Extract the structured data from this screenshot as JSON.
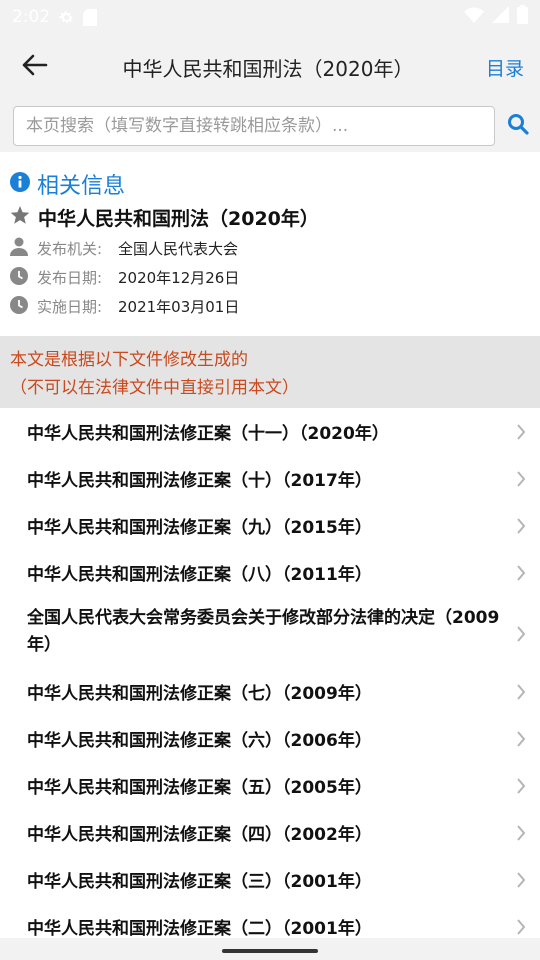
{
  "status_bar": {
    "time": "2:02",
    "icons": [
      "gear-icon",
      "sd-card-icon",
      "wifi-icon",
      "signal-icon",
      "battery-icon"
    ]
  },
  "app_bar": {
    "title": "中华人民共和国刑法（2020年）",
    "toc_label": "目录",
    "back_icon": "arrow-left-icon"
  },
  "search": {
    "placeholder": "本页搜索（填写数字直接转跳相应条款）...",
    "value": ""
  },
  "info": {
    "heading": "相关信息",
    "law_title": "中华人民共和国刑法（2020年）",
    "rows": [
      {
        "key": "发布机关:",
        "value": "全国人民代表大会",
        "icon": "person-icon"
      },
      {
        "key": "发布日期:",
        "value": "2020年12月26日",
        "icon": "clock-icon"
      },
      {
        "key": "实施日期:",
        "value": "2021年03月01日",
        "icon": "clock-icon"
      }
    ]
  },
  "notice": {
    "line1": "本文是根据以下文件修改生成的",
    "line2": "（不可以在法律文件中直接引用本文）"
  },
  "amendments": [
    "中华人民共和国刑法修正案（十一）（2020年）",
    "中华人民共和国刑法修正案（十）（2017年）",
    "中华人民共和国刑法修正案（九）（2015年）",
    "中华人民共和国刑法修正案（八）（2011年）",
    "全国人民代表大会常务委员会关于修改部分法律的决定（2009年）",
    "中华人民共和国刑法修正案（七）（2009年）",
    "中华人民共和国刑法修正案（六）（2006年）",
    "中华人民共和国刑法修正案（五）（2005年）",
    "中华人民共和国刑法修正案（四）（2002年）",
    "中华人民共和国刑法修正案（三）（2001年）",
    "中华人民共和国刑法修正案（二）（2001年）"
  ],
  "colors": {
    "accent": "#1a7fd6",
    "notice_text": "#c84a1e",
    "notice_bg": "#e4e4e4"
  }
}
